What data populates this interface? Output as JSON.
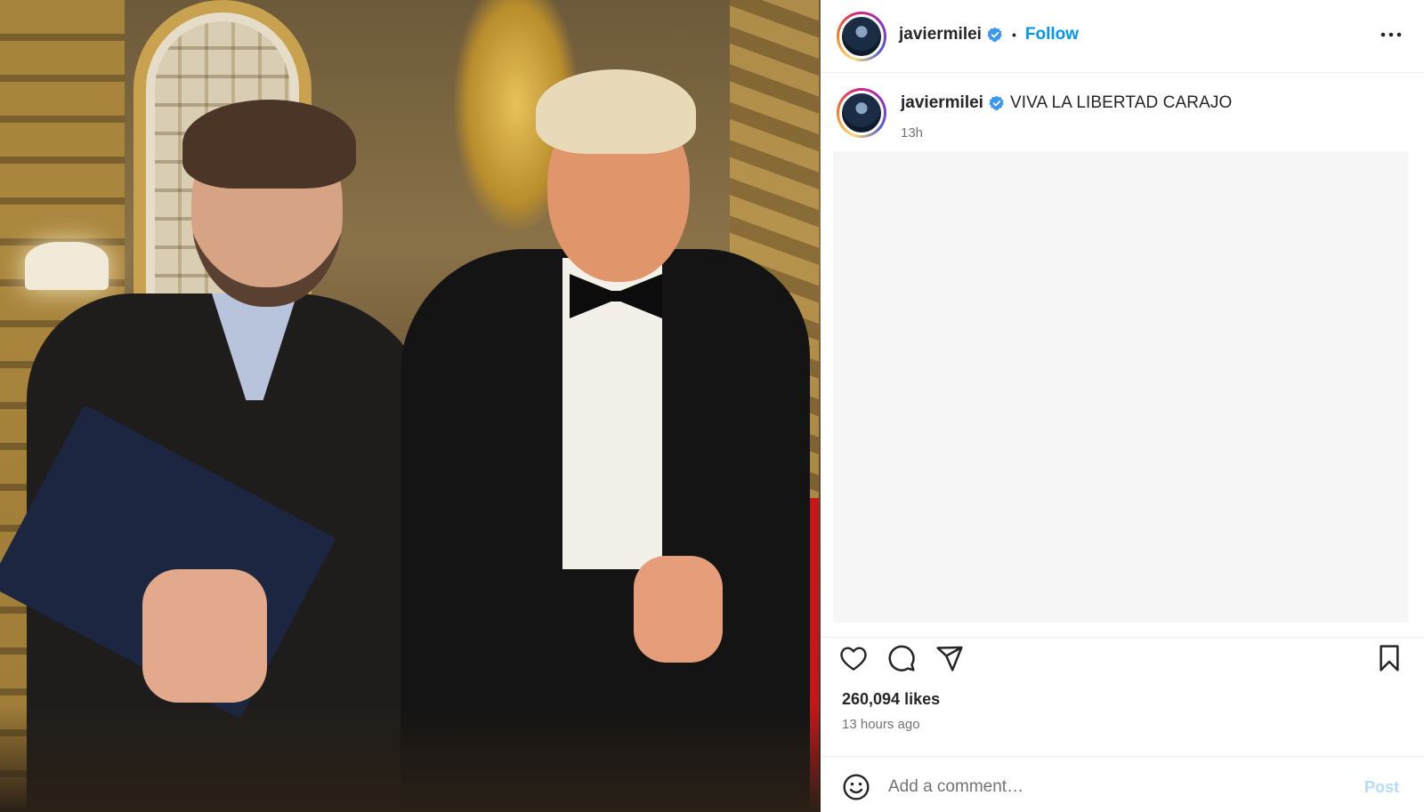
{
  "post": {
    "username": "javiermilei",
    "verified_icon": "verified-badge-icon",
    "separator": "•",
    "follow_label": "Follow",
    "more_icon": "more-options-icon",
    "caption": "VIVA LA LIBERTAD CARAJO",
    "caption_time": "13h",
    "likes": "260,094 likes",
    "posted_ago": "13 hours ago"
  },
  "actions": {
    "like_icon": "heart-icon",
    "comment_icon": "comment-icon",
    "share_icon": "share-icon",
    "save_icon": "bookmark-icon"
  },
  "comment_bar": {
    "emoji_icon": "emoji-icon",
    "placeholder": "Add a comment…",
    "post_label": "Post"
  },
  "colors": {
    "accent": "#0095f6",
    "verified": "#3897f0",
    "post_disabled": "#b3dbff",
    "muted_text": "#737373"
  }
}
